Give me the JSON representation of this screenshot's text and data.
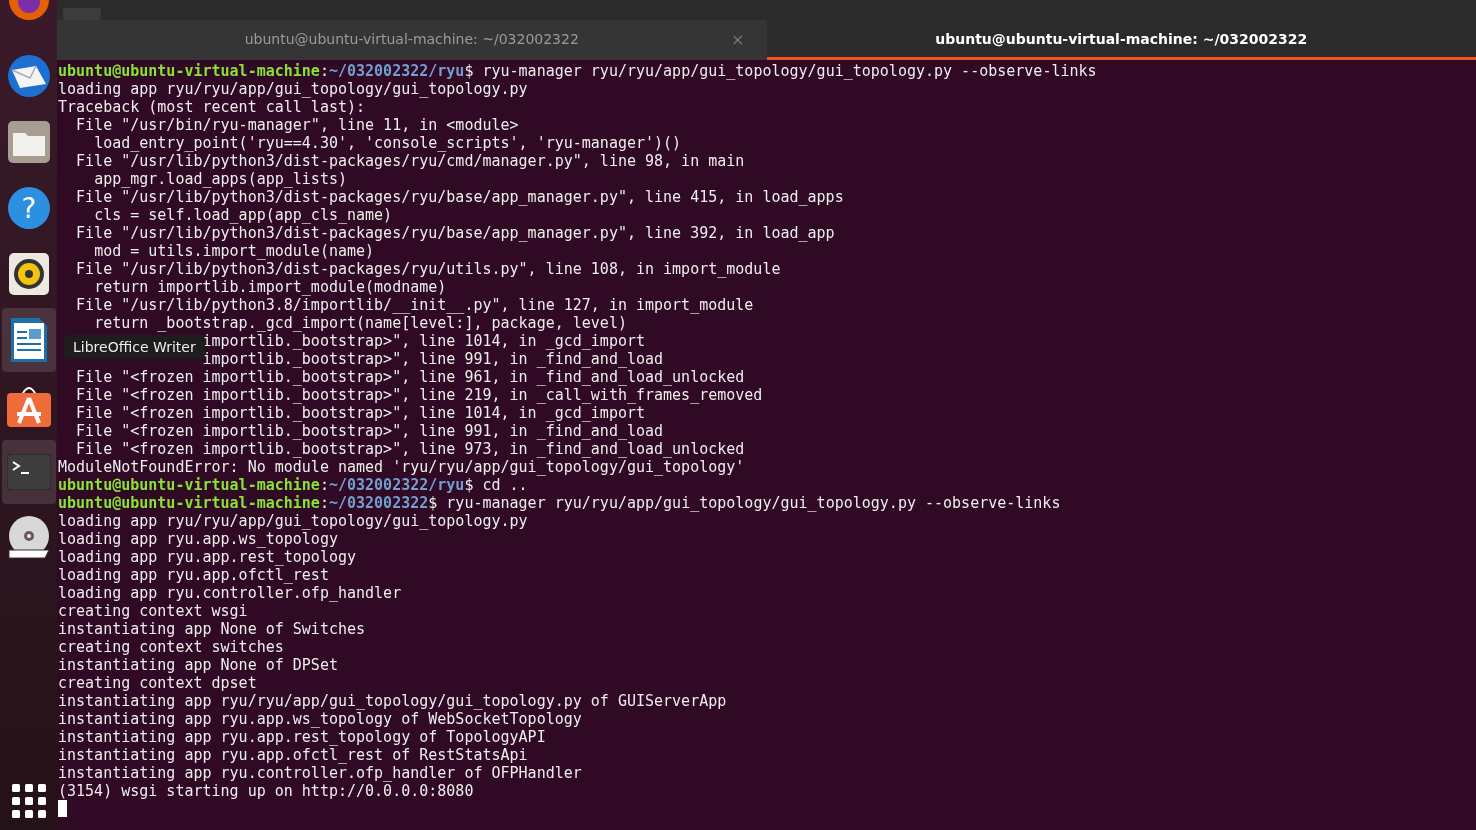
{
  "dock": {
    "items": [
      {
        "kind": "firefox",
        "active": false
      },
      {
        "kind": "mail",
        "active": false
      },
      {
        "kind": "files",
        "active": false
      },
      {
        "kind": "help",
        "active": false,
        "glyph": "?"
      },
      {
        "kind": "music",
        "active": false
      },
      {
        "kind": "writer",
        "active": true
      },
      {
        "kind": "software",
        "active": false
      },
      {
        "kind": "terminal",
        "active": true
      },
      {
        "kind": "dvd",
        "active": false
      }
    ],
    "tooltip": "LibreOffice Writer"
  },
  "tabs": [
    {
      "label": "ubuntu@ubuntu-virtual-machine: ~/032002322",
      "selected": false,
      "close": "×"
    },
    {
      "label": "ubuntu@ubuntu-virtual-machine: ~/032002322",
      "selected": true
    }
  ],
  "terminal": {
    "lines": [
      {
        "kind": "prompt",
        "user": "ubuntu@ubuntu-virtual-machine",
        "separator": ":",
        "path": "~/032002322/ryu",
        "command": "$ ryu-manager ryu/ryu/app/gui_topology/gui_topology.py --observe-links"
      },
      {
        "kind": "output",
        "text": "loading app ryu/ryu/app/gui_topology/gui_topology.py"
      },
      {
        "kind": "output",
        "text": "Traceback (most recent call last):"
      },
      {
        "kind": "output",
        "text": "  File \"/usr/bin/ryu-manager\", line 11, in <module>"
      },
      {
        "kind": "output",
        "text": "    load_entry_point('ryu==4.30', 'console_scripts', 'ryu-manager')()"
      },
      {
        "kind": "output",
        "text": "  File \"/usr/lib/python3/dist-packages/ryu/cmd/manager.py\", line 98, in main"
      },
      {
        "kind": "output",
        "text": "    app_mgr.load_apps(app_lists)"
      },
      {
        "kind": "output",
        "text": "  File \"/usr/lib/python3/dist-packages/ryu/base/app_manager.py\", line 415, in load_apps"
      },
      {
        "kind": "output",
        "text": "    cls = self.load_app(app_cls_name)"
      },
      {
        "kind": "output",
        "text": "  File \"/usr/lib/python3/dist-packages/ryu/base/app_manager.py\", line 392, in load_app"
      },
      {
        "kind": "output",
        "text": "    mod = utils.import_module(name)"
      },
      {
        "kind": "output",
        "text": "  File \"/usr/lib/python3/dist-packages/ryu/utils.py\", line 108, in import_module"
      },
      {
        "kind": "output",
        "text": "    return importlib.import_module(modname)"
      },
      {
        "kind": "output",
        "text": "  File \"/usr/lib/python3.8/importlib/__init__.py\", line 127, in import_module"
      },
      {
        "kind": "output",
        "text": "    return _bootstrap._gcd_import(name[level:], package, level)"
      },
      {
        "kind": "output",
        "text": "                importlib._bootstrap>\", line 1014, in _gcd_import"
      },
      {
        "kind": "output",
        "text": "                importlib._bootstrap>\", line 991, in _find_and_load"
      },
      {
        "kind": "output",
        "text": "  File \"<frozen importlib._bootstrap>\", line 961, in _find_and_load_unlocked"
      },
      {
        "kind": "output",
        "text": "  File \"<frozen importlib._bootstrap>\", line 219, in _call_with_frames_removed"
      },
      {
        "kind": "output",
        "text": "  File \"<frozen importlib._bootstrap>\", line 1014, in _gcd_import"
      },
      {
        "kind": "output",
        "text": "  File \"<frozen importlib._bootstrap>\", line 991, in _find_and_load"
      },
      {
        "kind": "output",
        "text": "  File \"<frozen importlib._bootstrap>\", line 973, in _find_and_load_unlocked"
      },
      {
        "kind": "output",
        "text": "ModuleNotFoundError: No module named 'ryu/ryu/app/gui_topology/gui_topology'"
      },
      {
        "kind": "prompt",
        "user": "ubuntu@ubuntu-virtual-machine",
        "separator": ":",
        "path": "~/032002322/ryu",
        "command": "$ cd .."
      },
      {
        "kind": "prompt",
        "user": "ubuntu@ubuntu-virtual-machine",
        "separator": ":",
        "path": "~/032002322",
        "command": "$ ryu-manager ryu/ryu/app/gui_topology/gui_topology.py --observe-links"
      },
      {
        "kind": "output",
        "text": "loading app ryu/ryu/app/gui_topology/gui_topology.py"
      },
      {
        "kind": "output",
        "text": "loading app ryu.app.ws_topology"
      },
      {
        "kind": "output",
        "text": "loading app ryu.app.rest_topology"
      },
      {
        "kind": "output",
        "text": "loading app ryu.app.ofctl_rest"
      },
      {
        "kind": "output",
        "text": "loading app ryu.controller.ofp_handler"
      },
      {
        "kind": "output",
        "text": "creating context wsgi"
      },
      {
        "kind": "output",
        "text": "instantiating app None of Switches"
      },
      {
        "kind": "output",
        "text": "creating context switches"
      },
      {
        "kind": "output",
        "text": "instantiating app None of DPSet"
      },
      {
        "kind": "output",
        "text": "creating context dpset"
      },
      {
        "kind": "output",
        "text": "instantiating app ryu/ryu/app/gui_topology/gui_topology.py of GUIServerApp"
      },
      {
        "kind": "output",
        "text": "instantiating app ryu.app.ws_topology of WebSocketTopology"
      },
      {
        "kind": "output",
        "text": "instantiating app ryu.app.rest_topology of TopologyAPI"
      },
      {
        "kind": "output",
        "text": "instantiating app ryu.app.ofctl_rest of RestStatsApi"
      },
      {
        "kind": "output",
        "text": "instantiating app ryu.controller.ofp_handler of OFPHandler"
      },
      {
        "kind": "output",
        "text": "(3154) wsgi starting up on http://0.0.0.0:8080"
      },
      {
        "kind": "cursor"
      }
    ]
  }
}
